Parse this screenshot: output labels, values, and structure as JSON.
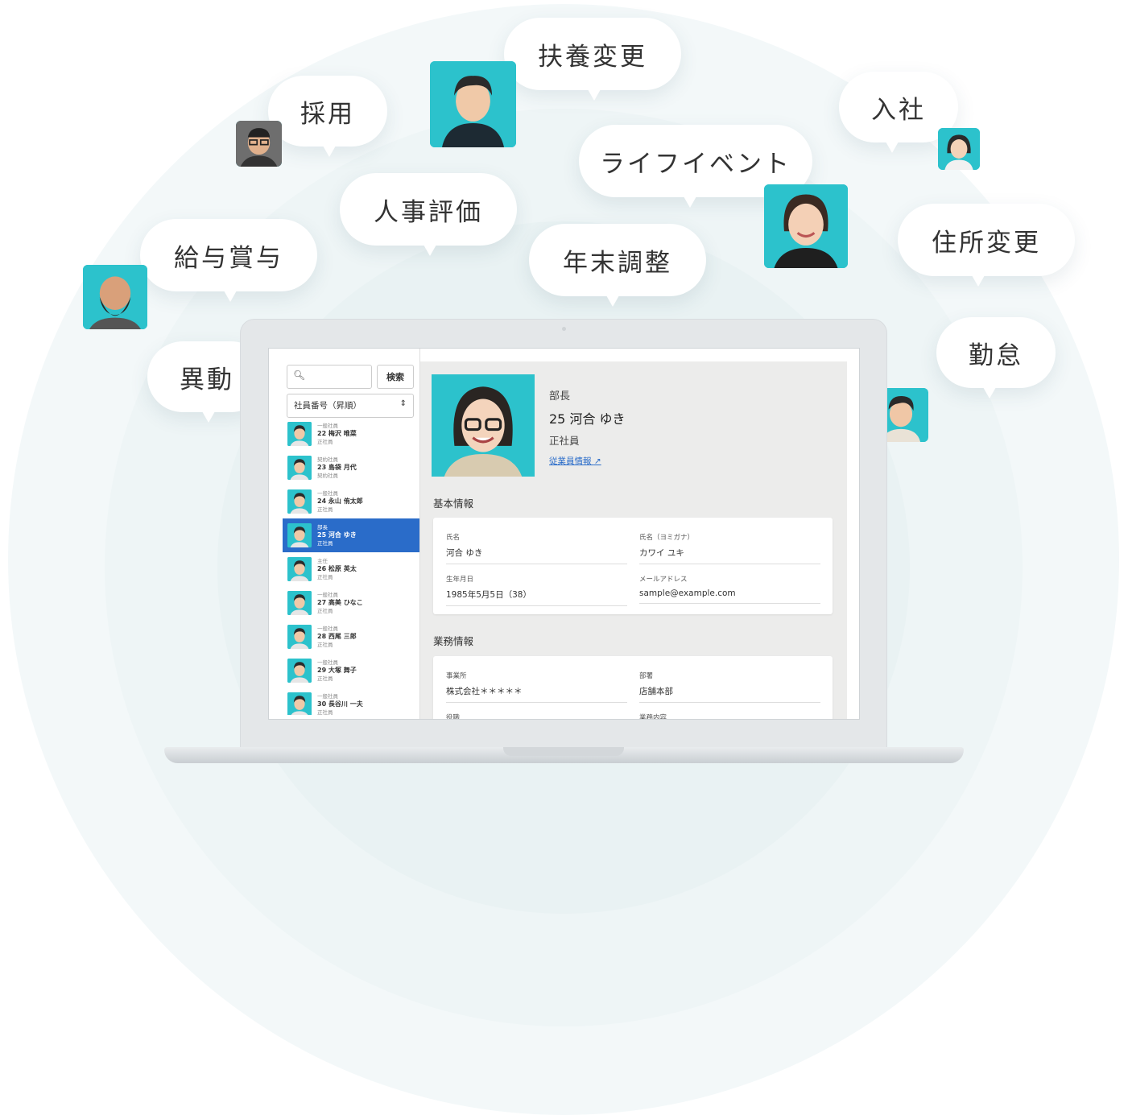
{
  "bubbles": {
    "fuyo": "扶養変更",
    "saiyo": "採用",
    "nyusha": "入社",
    "life": "ライフイベント",
    "hyoka": "人事評価",
    "kyuyo": "給与賞与",
    "nenmatsu": "年末調整",
    "jusho": "住所変更",
    "kintai": "勤怠",
    "ido": "異動"
  },
  "sidebar": {
    "search_button": "検索",
    "sort_value": "社員番号（昇順）",
    "employees": [
      {
        "role": "一般社員",
        "name": "22  梅沢 唯菜",
        "type": "正社員"
      },
      {
        "role": "契約社員",
        "name": "23  島袋 月代",
        "type": "契約社員"
      },
      {
        "role": "一般社員",
        "name": "24  永山 侑太郎",
        "type": "正社員"
      },
      {
        "role": "部長",
        "name": "25  河合 ゆき",
        "type": "正社員"
      },
      {
        "role": "主任",
        "name": "26  松原 英太",
        "type": "正社員"
      },
      {
        "role": "一般社員",
        "name": "27  高美 ひなこ",
        "type": "正社員"
      },
      {
        "role": "一般社員",
        "name": "28  西尾 三郎",
        "type": "正社員"
      },
      {
        "role": "一般社員",
        "name": "29  大塚 舞子",
        "type": "正社員"
      },
      {
        "role": "一般社員",
        "name": "30  長谷川 一夫",
        "type": "正社員"
      }
    ]
  },
  "detail": {
    "position": "部長",
    "name": "25 河合 ゆき",
    "employment_type": "正社員",
    "link": "従業員情報",
    "basic_title": "基本情報",
    "basic": {
      "name_label": "氏名",
      "name_value": "河合 ゆき",
      "kana_label": "氏名（ヨミガナ）",
      "kana_value": "カワイ ユキ",
      "birth_label": "生年月日",
      "birth_value": "1985年5月5日（38）",
      "mail_label": "メールアドレス",
      "mail_value": "sample@example.com"
    },
    "work_title": "業務情報",
    "work": {
      "office_label": "事業所",
      "office_value": "株式会社＊＊＊＊＊",
      "dept_label": "部署",
      "dept_value": "店舗本部",
      "post_label": "役職",
      "duty_label": "業務内容"
    }
  },
  "colors": {
    "accent": "#2a6cc9",
    "photo_bg": "#2cc2cc"
  }
}
